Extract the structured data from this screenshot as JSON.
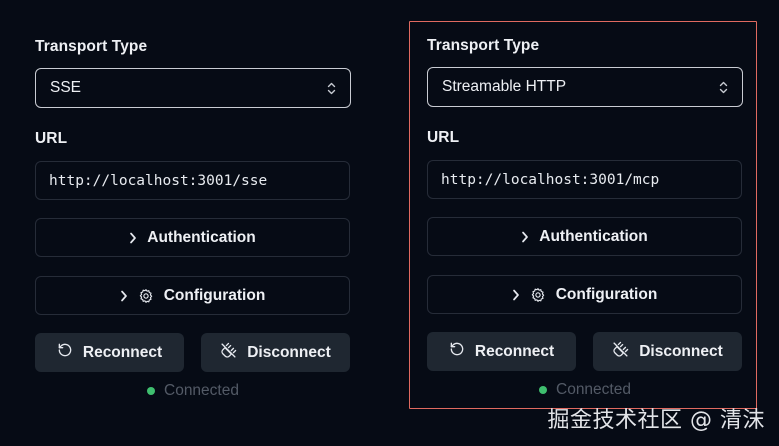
{
  "left_panel": {
    "transport_label": "Transport Type",
    "transport_value": "SSE",
    "url_label": "URL",
    "url_value": "http://localhost:3001/sse",
    "authentication_label": "Authentication",
    "configuration_label": "Configuration",
    "reconnect_label": "Reconnect",
    "disconnect_label": "Disconnect",
    "status_text": "Connected"
  },
  "right_panel": {
    "transport_label": "Transport Type",
    "transport_value": "Streamable HTTP",
    "url_label": "URL",
    "url_value": "http://localhost:3001/mcp",
    "authentication_label": "Authentication",
    "configuration_label": "Configuration",
    "reconnect_label": "Reconnect",
    "disconnect_label": "Disconnect",
    "status_text": "Connected"
  },
  "watermark": "掘金技术社区 @ 清沫",
  "colors": {
    "background": "#060b15",
    "highlight_border": "#e06a60",
    "status_dot": "#3fbf6f",
    "button_bg": "#1f2731"
  },
  "icons": {
    "select_chevron": "chevron-up-down-icon",
    "expander_chevron": "chevron-right-icon",
    "configuration": "gear-icon",
    "reconnect": "rotate-ccw-icon",
    "disconnect": "unplug-icon"
  }
}
